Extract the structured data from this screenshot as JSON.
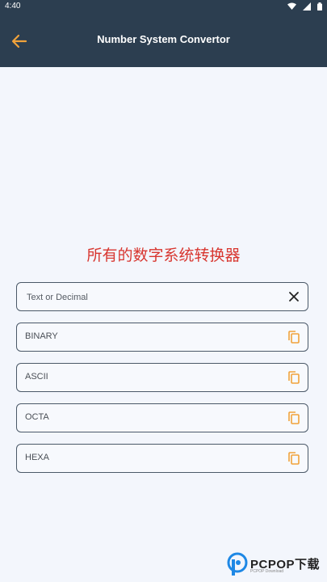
{
  "status_bar": {
    "time": "4:40"
  },
  "app_bar": {
    "title": "Number System Convertor",
    "accent_color": "#f0a23b",
    "background": "#2c3e50"
  },
  "main": {
    "heading": "所有的数字系统转换器",
    "heading_color": "#d8362f",
    "input": {
      "placeholder": "Text or Decimal",
      "value": "",
      "action_icon": "close-icon"
    },
    "outputs": [
      {
        "label": "BINARY",
        "action_icon": "copy-icon"
      },
      {
        "label": "ASCII",
        "action_icon": "copy-icon"
      },
      {
        "label": "OCTA",
        "action_icon": "copy-icon"
      },
      {
        "label": "HEXA",
        "action_icon": "copy-icon"
      }
    ]
  },
  "watermark": {
    "text": "PCPOP下载",
    "subtext": "PCPOP Download"
  }
}
